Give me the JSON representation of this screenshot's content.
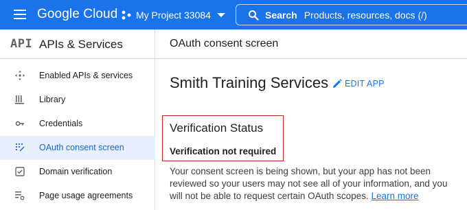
{
  "header": {
    "logo_text": "Google Cloud",
    "project_name": "My Project 33084",
    "search_label": "Search",
    "search_placeholder": "Products, resources, docs (/)"
  },
  "sidebar": {
    "badge": "API",
    "title": "APIs & Services",
    "items": [
      {
        "label": "Enabled APIs & services",
        "icon": "api-services-icon",
        "active": false
      },
      {
        "label": "Library",
        "icon": "library-icon",
        "active": false
      },
      {
        "label": "Credentials",
        "icon": "key-icon",
        "active": false
      },
      {
        "label": "OAuth consent screen",
        "icon": "consent-icon",
        "active": true
      },
      {
        "label": "Domain verification",
        "icon": "checkbox-icon",
        "active": false
      },
      {
        "label": "Page usage agreements",
        "icon": "settings-list-icon",
        "active": false
      }
    ]
  },
  "main": {
    "page_title": "OAuth consent screen",
    "app_name": "Smith Training Services",
    "edit_label": "EDIT APP",
    "verification_title": "Verification Status",
    "verification_status": "Verification not required",
    "description": "Your consent screen is being shown, but your app has not been reviewed so your users may not see all of your information, and you will not be able to request certain OAuth scopes.",
    "learn_more": "Learn more"
  },
  "colors": {
    "brand_blue": "#1a73e8",
    "active_bg": "#e8f0fe",
    "highlight_red": "#c5221f"
  }
}
